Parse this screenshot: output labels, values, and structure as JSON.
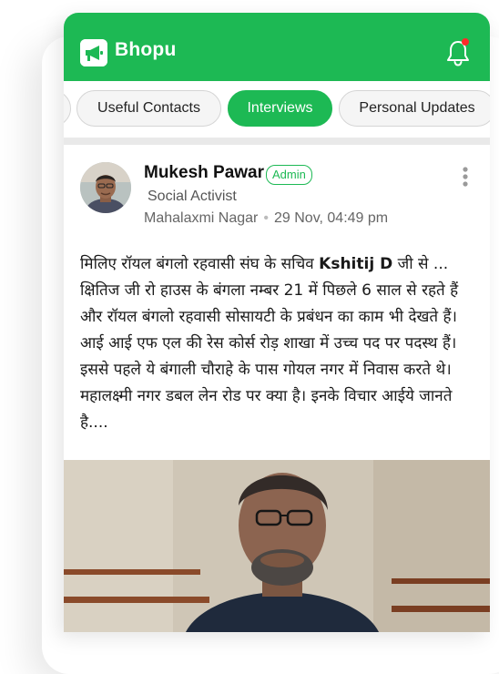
{
  "app": {
    "title": "Bhopu"
  },
  "tabs": [
    {
      "label": ""
    },
    {
      "label": "Useful Contacts"
    },
    {
      "label": "Interviews",
      "active": true
    },
    {
      "label": "Personal Updates"
    }
  ],
  "post": {
    "author": "Mukesh Pawar",
    "badge": "Admin",
    "role": "Social Activist",
    "location": "Mahalaxmi Nagar",
    "timestamp": "29 Nov, 04:49 pm",
    "text_before": "मिलिए रॉयल बंगलो रहवासी संघ के सचिव ",
    "text_bold": "Kshitij D",
    "text_after": " जी से ... क्षितिज जी रो हाउस के बंगला नम्बर 21 में पिछले 6 साल से रहते हैं और रॉयल बंगलो रहवासी सोसायटी के प्रबंधन का काम भी देखते हैं।  आई आई एफ एल की रेस कोर्स रोड़ शाखा में उच्च पद पर पदस्थ हैं। इससे पहले ये बंगाली चौराहे के पास गोयल नगर में निवास करते थे। महालक्ष्मी नगर डबल लेन रोड पर क्या है। इनके विचार आईये जानते है...."
  },
  "colors": {
    "brand": "#1db954",
    "notification": "#ff2a2a"
  },
  "icons": {
    "logo": "megaphone-icon",
    "notifications": "bell-icon",
    "more": "more-vertical-icon"
  }
}
